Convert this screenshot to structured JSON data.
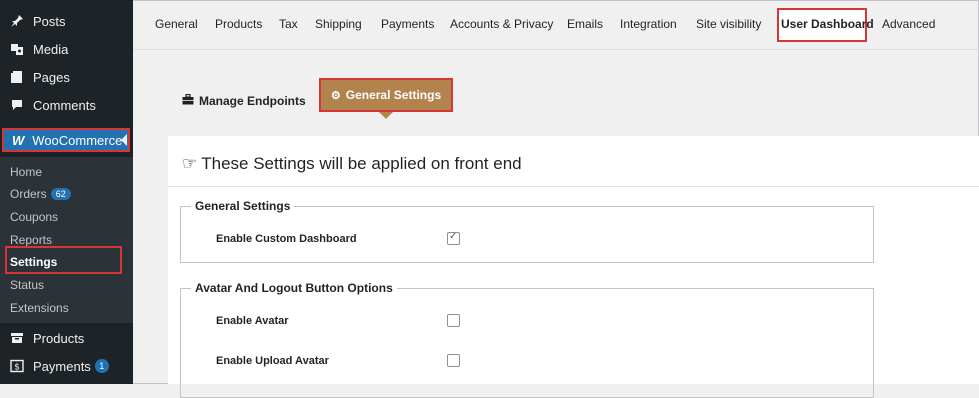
{
  "sidebar": {
    "items_top": [
      {
        "label": "Posts",
        "icon": "pin-icon"
      },
      {
        "label": "Media",
        "icon": "media-icon"
      },
      {
        "label": "Pages",
        "icon": "pages-icon"
      },
      {
        "label": "Comments",
        "icon": "comments-icon"
      }
    ],
    "woocommerce": {
      "label": "WooCommerce",
      "icon_glyph": "W"
    },
    "submenu": [
      {
        "label": "Home"
      },
      {
        "label": "Orders",
        "badge": "62"
      },
      {
        "label": "Coupons"
      },
      {
        "label": "Reports"
      },
      {
        "label": "Settings"
      },
      {
        "label": "Status"
      },
      {
        "label": "Extensions"
      }
    ],
    "items_bottom": [
      {
        "label": "Products",
        "icon": "products-icon"
      },
      {
        "label": "Payments",
        "icon": "payments-icon",
        "badge": "1"
      }
    ]
  },
  "tabs": [
    "General",
    "Products",
    "Tax",
    "Shipping",
    "Payments",
    "Accounts & Privacy",
    "Emails",
    "Integration",
    "Site visibility",
    "User Dashboard",
    "Advanced"
  ],
  "inner_tabs": {
    "manage": "Manage Endpoints",
    "general": "General Settings"
  },
  "panel": {
    "heading": "These Settings will be applied on front end",
    "general_fieldset": {
      "legend": "General Settings",
      "rows": [
        {
          "label": "Enable Custom Dashboard",
          "checked": true
        }
      ]
    },
    "avatar_fieldset": {
      "legend": "Avatar And Logout Button Options",
      "rows": [
        {
          "label": "Enable Avatar",
          "checked": false
        },
        {
          "label": "Enable Upload Avatar",
          "checked": false
        }
      ]
    }
  },
  "colors": {
    "sidebar_bg": "#1d2327",
    "submenu_bg": "#2c3338",
    "accent": "#2271b1",
    "highlight": "#d63638",
    "active_tab_bg": "#b2834c"
  }
}
